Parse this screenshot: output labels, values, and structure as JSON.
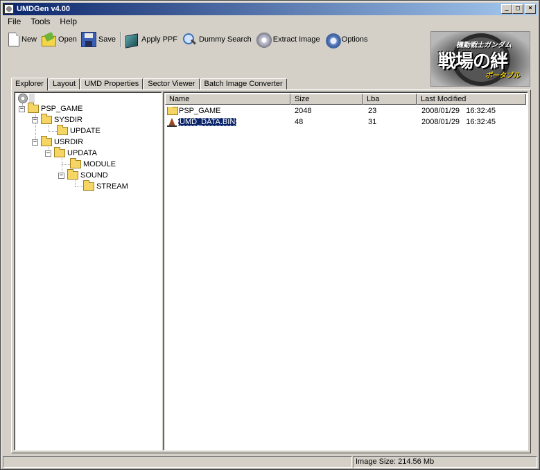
{
  "window": {
    "title": "UMDGen v4.00",
    "min": "_",
    "max": "□",
    "close": "×"
  },
  "menu": [
    {
      "label": "File"
    },
    {
      "label": "Tools"
    },
    {
      "label": "Help"
    }
  ],
  "toolbar": {
    "new_label": "New",
    "open_label": "Open",
    "save_label": "Save",
    "applyppf_label": "Apply PPF",
    "dummysearch_label": "Dummy Search",
    "extract_label": "Extract Image",
    "options_label": "Options"
  },
  "logo": {
    "top": "機動戦士ガンダム",
    "main": "戦場の絆",
    "sub": "ポータブル"
  },
  "tabs": [
    {
      "label": "Explorer",
      "active": true
    },
    {
      "label": "Layout"
    },
    {
      "label": "UMD Properties"
    },
    {
      "label": "Sector Viewer"
    },
    {
      "label": "Batch Image Converter"
    }
  ],
  "tree": [
    {
      "label": "PSP_GAME"
    },
    {
      "label": "SYSDIR"
    },
    {
      "label": "UPDATE"
    },
    {
      "label": "USRDIR"
    },
    {
      "label": "UPDATA"
    },
    {
      "label": "MODULE"
    },
    {
      "label": "SOUND"
    },
    {
      "label": "STREAM"
    }
  ],
  "expander_symbol": "−",
  "list": {
    "columns": [
      "Name",
      "Size",
      "Lba",
      "Last Modified"
    ],
    "rows": [
      {
        "name": "PSP_GAME",
        "size": "2048",
        "lba": "23",
        "modified": "2008/01/29   16:32:45",
        "type": "folder"
      },
      {
        "name": "UMD_DATA.BIN",
        "size": "48",
        "lba": "31",
        "modified": "2008/01/29   16:32:45",
        "type": "file",
        "selected": true
      }
    ]
  },
  "status": {
    "image_size": "Image Size: 214.56 Mb"
  },
  "colors": {
    "titlebar_start": "#0a246a",
    "titlebar_end": "#a6caf0",
    "selection": "#0a246a",
    "face": "#d4d0c8"
  }
}
